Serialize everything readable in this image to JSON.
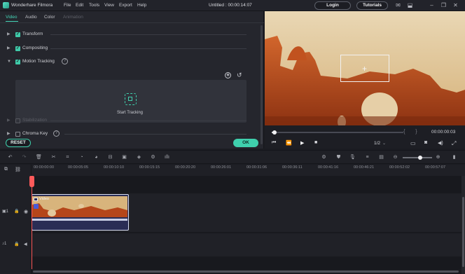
{
  "app": {
    "title": "Wonderhare Filmora",
    "document": "Untitled : 00:00:14:07"
  },
  "menu": [
    "File",
    "Edit",
    "Tools",
    "View",
    "Export",
    "Help"
  ],
  "header_buttons": {
    "login": "Login",
    "tutorials": "Tutorials"
  },
  "panel": {
    "tabs": [
      "Video",
      "Audio",
      "Color",
      "Animation"
    ],
    "active_tab": "Video",
    "sections": {
      "transform": "Transform",
      "compositing": "Compositing",
      "motion_tracking": "Motion Tracking",
      "stabilization": "Stabilization",
      "chroma_key": "Chroma Key"
    },
    "start_tracking": "Start Tracking",
    "reset": "RESET",
    "ok": "OK"
  },
  "preview": {
    "time": "00:00:00:03",
    "quality": "1/2",
    "progress": 0.02
  },
  "ruler_ticks": [
    "00:00:00:00",
    "00:00:05:05",
    "00:00:10:10",
    "00:00:15:15",
    "00:00:20:20",
    "00:00:26:01",
    "00:00:31:06",
    "00:00:36:11",
    "00:00:41:16",
    "00:00:46:21",
    "00:00:52:02",
    "00:00:57:07"
  ],
  "clip": {
    "label": "Video"
  },
  "colors": {
    "accent": "#3fd0ad",
    "background": "#1b1c22",
    "panel": "#25262d",
    "playhead": "#ff5a5a",
    "clip": "#2a2d55"
  }
}
